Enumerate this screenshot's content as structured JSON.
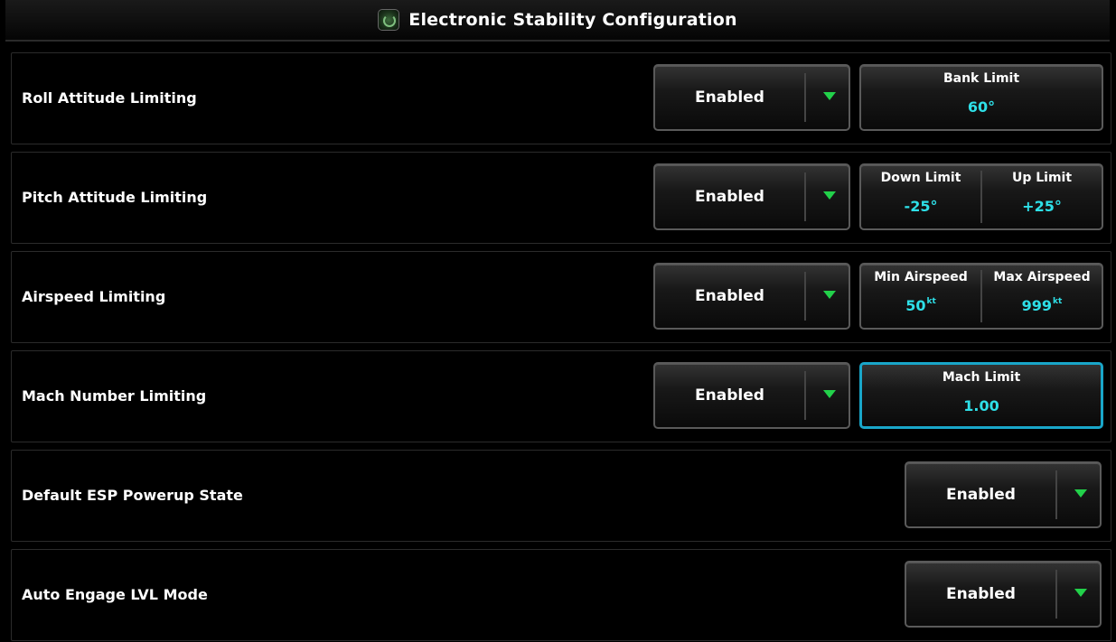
{
  "header": {
    "title": "Electronic Stability Configuration",
    "icon": "garmin-globe-icon"
  },
  "colors": {
    "accent_cyan": "#2ee0e8",
    "arrow_green": "#22d14a",
    "selected_border": "#19a6c9"
  },
  "rows": [
    {
      "label": "Roll Attitude Limiting",
      "dropdown": "Enabled",
      "limit": {
        "header": "Bank Limit",
        "value": "60°"
      }
    },
    {
      "label": "Pitch Attitude Limiting",
      "dropdown": "Enabled",
      "limits": [
        {
          "header": "Down Limit",
          "value": "-25°"
        },
        {
          "header": "Up Limit",
          "value": "+25°"
        }
      ]
    },
    {
      "label": "Airspeed Limiting",
      "dropdown": "Enabled",
      "limits": [
        {
          "header": "Min Airspeed",
          "value": "50",
          "unit": "kt"
        },
        {
          "header": "Max Airspeed",
          "value": "999",
          "unit": "kt"
        }
      ]
    },
    {
      "label": "Mach Number Limiting",
      "dropdown": "Enabled",
      "limit": {
        "header": "Mach Limit",
        "value": "1.00",
        "selected": true
      }
    },
    {
      "label": "Default ESP Powerup State",
      "dropdown": "Enabled"
    },
    {
      "label": "Auto Engage LVL Mode",
      "dropdown": "Enabled"
    }
  ]
}
